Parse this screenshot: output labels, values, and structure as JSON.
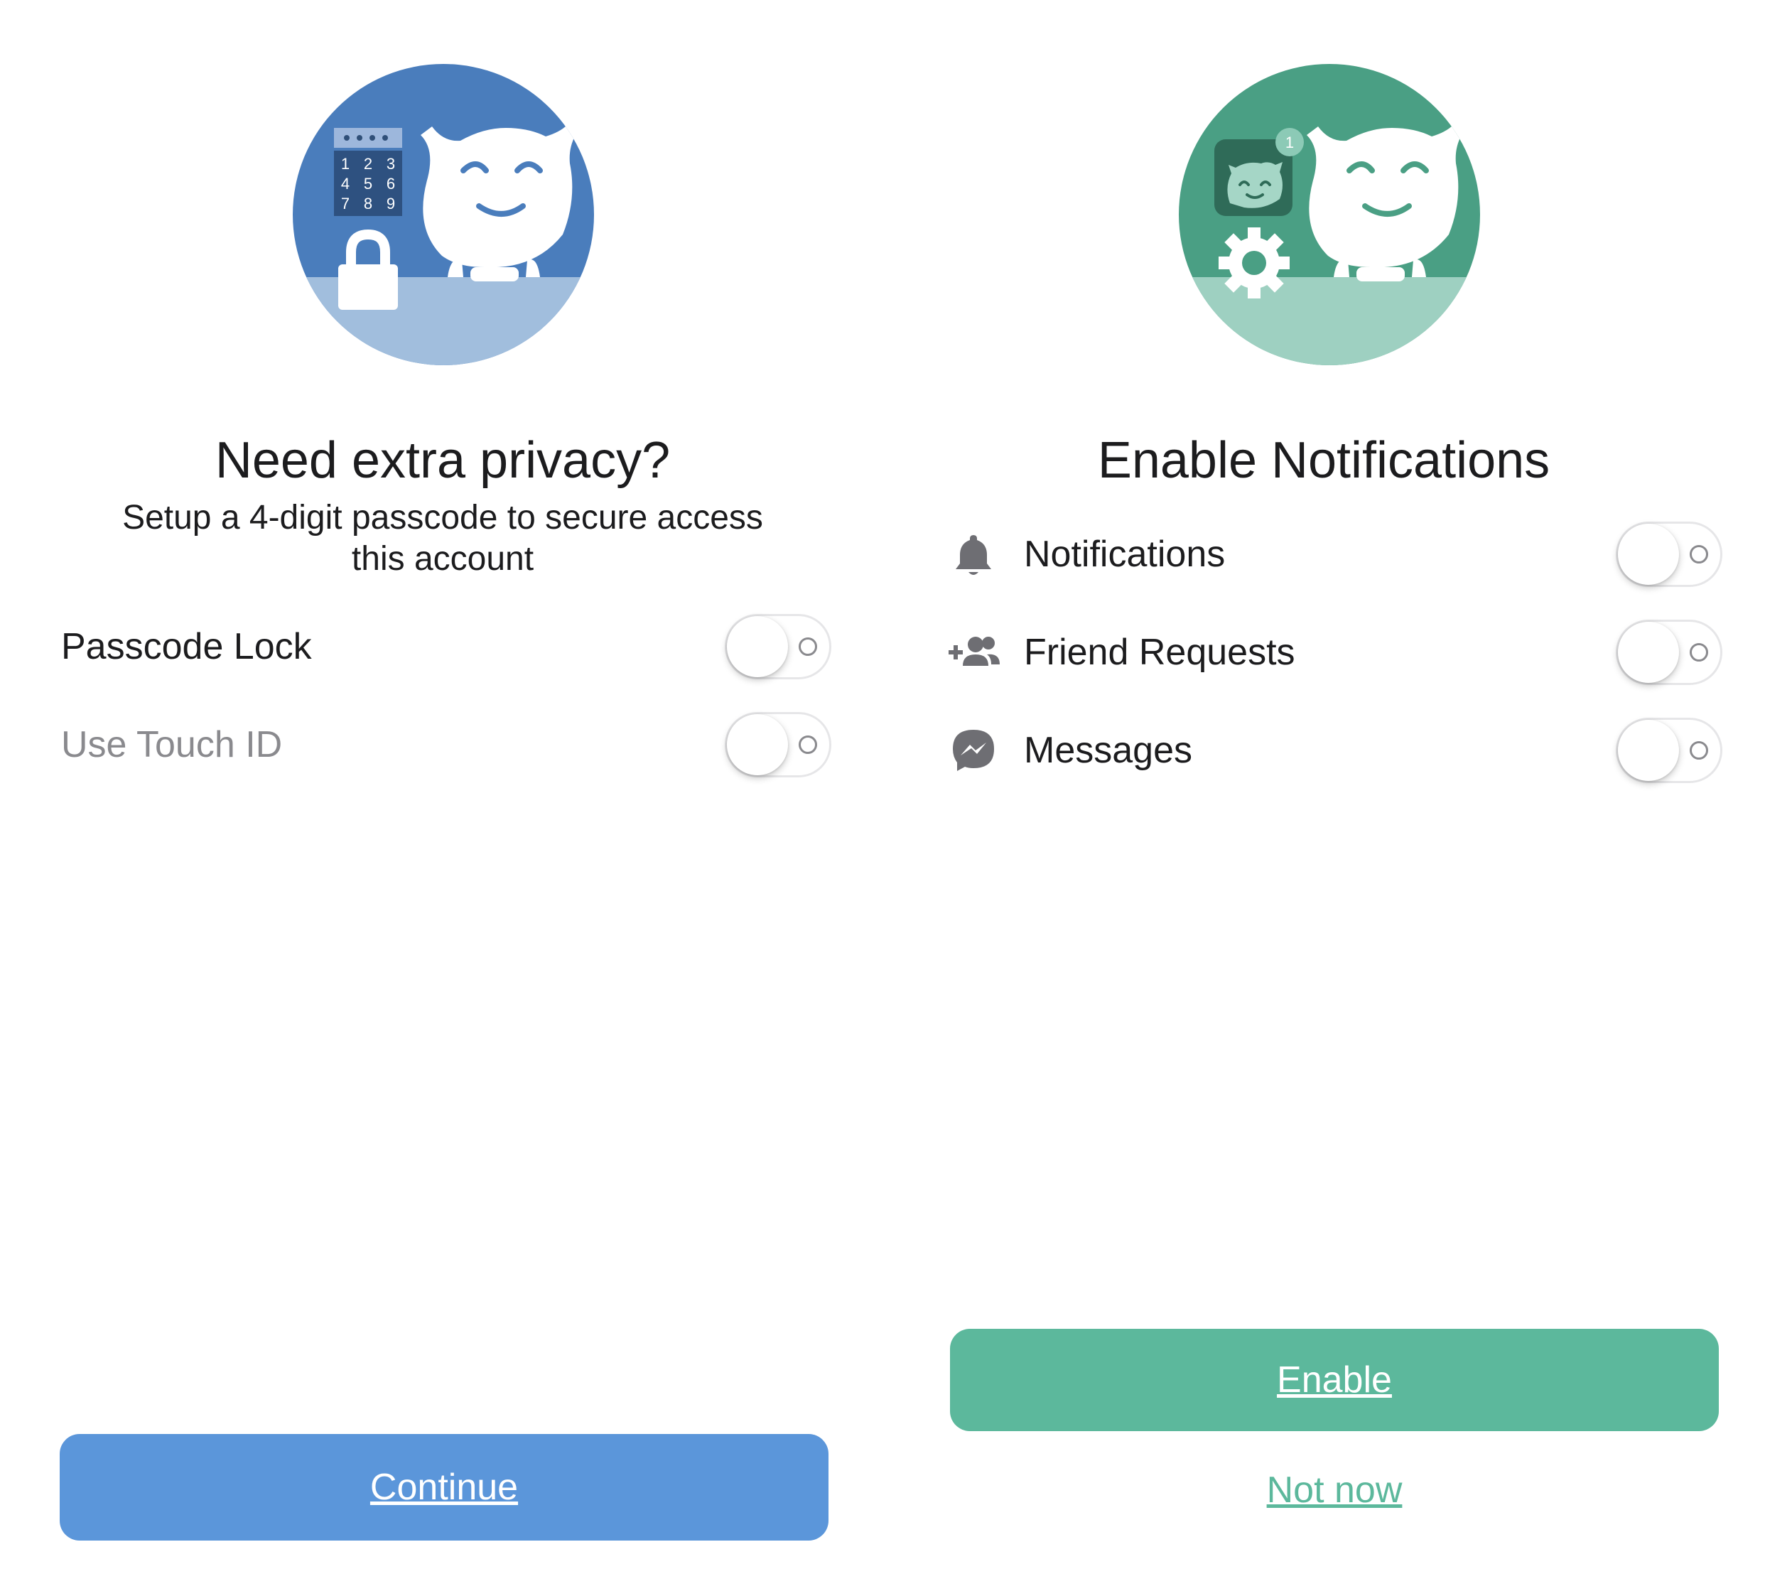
{
  "privacy": {
    "title": "Need extra privacy?",
    "subtitle": "Setup a 4-digit passcode to secure access this account",
    "keypad_digits": [
      "1",
      "2",
      "3",
      "4",
      "5",
      "6",
      "7",
      "8",
      "9"
    ],
    "settings": [
      {
        "label": "Passcode Lock",
        "enabled": false,
        "disabled": false
      },
      {
        "label": "Use Touch ID",
        "enabled": false,
        "disabled": true
      }
    ],
    "continue_label": "Continue",
    "accent_color": "#5b96da",
    "hero_color": "#4a7dbc"
  },
  "notifications": {
    "title": "Enable Notifications",
    "badge_count": "1",
    "settings": [
      {
        "label": "Notifications",
        "icon": "bell-icon",
        "enabled": false
      },
      {
        "label": "Friend Requests",
        "icon": "add-friend-icon",
        "enabled": false
      },
      {
        "label": "Messages",
        "icon": "messenger-icon",
        "enabled": false
      }
    ],
    "enable_label": "Enable",
    "not_now_label": "Not now",
    "accent_color": "#5cb89c",
    "hero_color": "#4a9f84"
  }
}
